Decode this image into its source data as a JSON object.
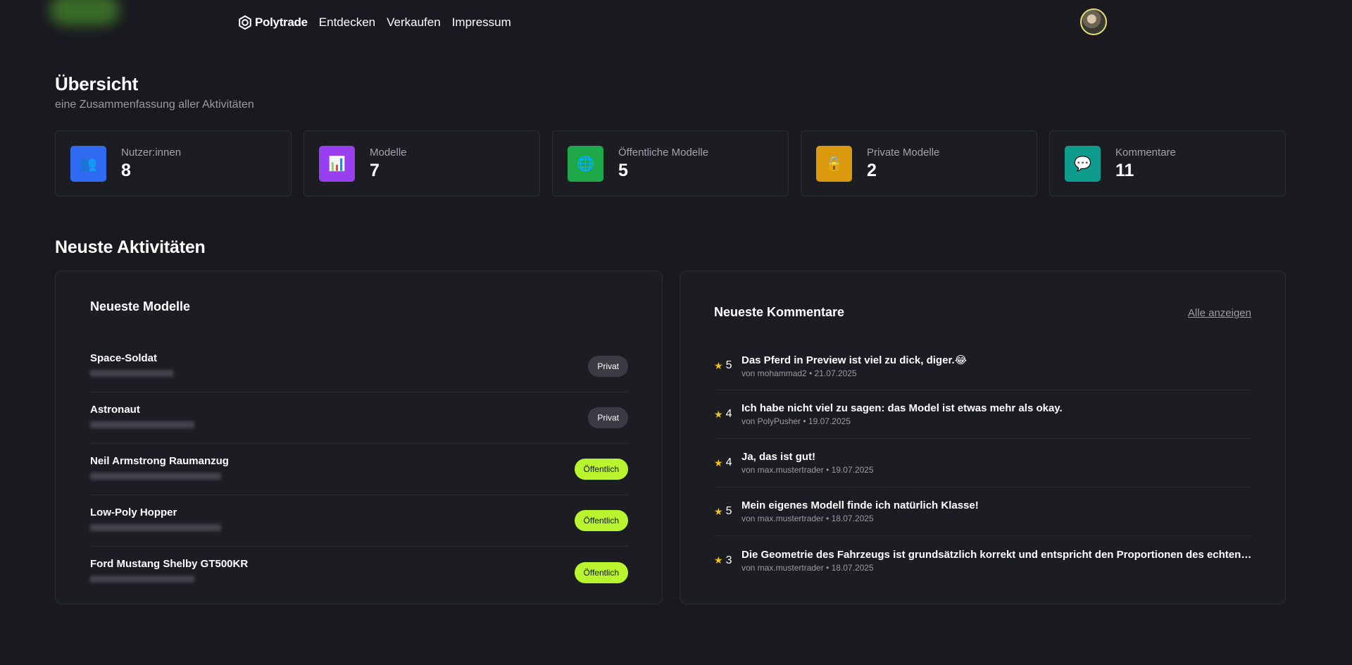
{
  "header": {
    "brand": "Polytrade",
    "nav": [
      "Entdecken",
      "Verkaufen",
      "Impressum"
    ]
  },
  "overview": {
    "title": "Übersicht",
    "subtitle": "eine Zusammenfassung aller Aktivitäten"
  },
  "stats": [
    {
      "label": "Nutzer:innen",
      "value": "8",
      "icon": "👥",
      "icon_name": "users-icon",
      "color": "#2f6bf0"
    },
    {
      "label": "Modelle",
      "value": "7",
      "icon": "📊",
      "icon_name": "chart-icon",
      "color": "#9a3ff0"
    },
    {
      "label": "Öffentliche Modelle",
      "value": "5",
      "icon": "🌐",
      "icon_name": "globe-icon",
      "color": "#1fa84a"
    },
    {
      "label": "Private Modelle",
      "value": "2",
      "icon": "🔒",
      "icon_name": "lock-icon",
      "color": "#db9a0e"
    },
    {
      "label": "Kommentare",
      "value": "11",
      "icon": "💬",
      "icon_name": "speech-bubble-icon",
      "color": "#109c8c"
    }
  ],
  "activities": {
    "title": "Neuste Aktivitäten",
    "models_title": "Neueste Modelle",
    "models": [
      {
        "name": "Space-Soldat",
        "badge": "Privat",
        "visibility": "private"
      },
      {
        "name": "Astronaut",
        "badge": "Privat",
        "visibility": "private"
      },
      {
        "name": "Neil Armstrong Raumanzug",
        "badge": "Öffentlich",
        "visibility": "public"
      },
      {
        "name": "Low-Poly Hopper",
        "badge": "Öffentlich",
        "visibility": "public"
      },
      {
        "name": "Ford Mustang Shelby GT500KR",
        "badge": "Öffentlich",
        "visibility": "public"
      }
    ],
    "comments_title": "Neueste Kommentare",
    "see_all": "Alle anzeigen",
    "comments": [
      {
        "rating": "5",
        "text": "Das Pferd in Preview ist viel zu dick, diger.😂",
        "meta": "von mohammad2 • 21.07.2025"
      },
      {
        "rating": "4",
        "text": "Ich habe nicht viel zu sagen: das Model ist etwas mehr als okay.",
        "meta": "von PolyPusher • 19.07.2025"
      },
      {
        "rating": "4",
        "text": "Ja, das ist gut!",
        "meta": "von max.mustertrader • 19.07.2025"
      },
      {
        "rating": "5",
        "text": "Mein eigenes Modell finde ich natürlich Klasse!",
        "meta": "von max.mustertrader • 18.07.2025"
      },
      {
        "rating": "3",
        "text": "Die Geometrie des Fahrzeugs ist grundsätzlich korrekt und entspricht den Proportionen des echten She...",
        "meta": "von max.mustertrader • 18.07.2025"
      }
    ]
  }
}
